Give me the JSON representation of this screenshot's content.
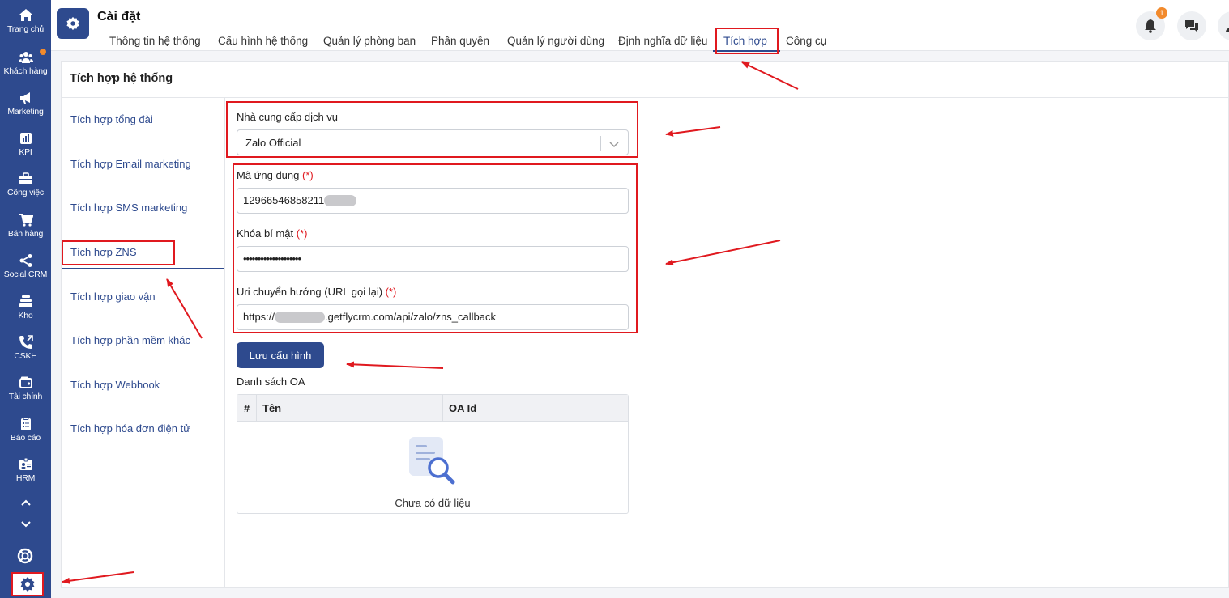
{
  "sidebar": {
    "items": [
      {
        "label": "Trang chủ",
        "icon": "home-icon"
      },
      {
        "label": "Khách hàng",
        "icon": "users-icon"
      },
      {
        "label": "Marketing",
        "icon": "megaphone-icon"
      },
      {
        "label": "KPI",
        "icon": "chart-icon"
      },
      {
        "label": "Công việc",
        "icon": "briefcase-icon"
      },
      {
        "label": "Bán hàng",
        "icon": "cart-icon"
      },
      {
        "label": "Social CRM",
        "icon": "share-icon"
      },
      {
        "label": "Kho",
        "icon": "warehouse-icon"
      },
      {
        "label": "CSKH",
        "icon": "phone-icon"
      },
      {
        "label": "Tài chính",
        "icon": "wallet-icon"
      },
      {
        "label": "Báo cáo",
        "icon": "clipboard-icon"
      },
      {
        "label": "HRM",
        "icon": "id-card-icon"
      }
    ]
  },
  "header": {
    "title": "Cài đặt",
    "tabs": [
      {
        "label": "Thông tin hệ thống"
      },
      {
        "label": "Cấu hình hệ thống"
      },
      {
        "label": "Quản lý phòng ban"
      },
      {
        "label": "Phân quyền"
      },
      {
        "label": "Quản lý người dùng"
      },
      {
        "label": "Định nghĩa dữ liệu"
      },
      {
        "label": "Tích hợp"
      },
      {
        "label": "Công cụ"
      }
    ],
    "notification_count": "1"
  },
  "panel": {
    "title": "Tích hợp hệ thống",
    "subnav": [
      {
        "label": "Tích hợp tổng đài"
      },
      {
        "label": "Tích hợp Email marketing"
      },
      {
        "label": "Tích hợp SMS marketing"
      },
      {
        "label": "Tích hợp ZNS"
      },
      {
        "label": "Tích hợp giao vận"
      },
      {
        "label": "Tích hợp phần mềm khác"
      },
      {
        "label": "Tích hợp Webhook"
      },
      {
        "label": "Tích hợp hóa đơn điện tử"
      }
    ]
  },
  "form": {
    "provider_label": "Nhà cung cấp dịch vụ",
    "provider_value": "Zalo Official",
    "app_id_label": "Mã ứng dụng",
    "app_id_value": "12966546858211",
    "required_mark": "(*)",
    "secret_label": "Khóa bí mật",
    "secret_value": "••••••••••••••••••••",
    "redirect_label": "Uri chuyển hướng (URL gọi lại)",
    "redirect_prefix": "https://",
    "redirect_suffix": ".getflycrm.com/api/zalo/zns_callback",
    "save_label": "Lưu cấu hình"
  },
  "oa_table": {
    "title": "Danh sách OA",
    "columns": [
      "#",
      "Tên",
      "OA Id"
    ],
    "empty_text": "Chưa có dữ liệu"
  },
  "colors": {
    "primary": "#2e4a8e",
    "annotation": "#e0191f",
    "badge": "#f28a2c"
  }
}
